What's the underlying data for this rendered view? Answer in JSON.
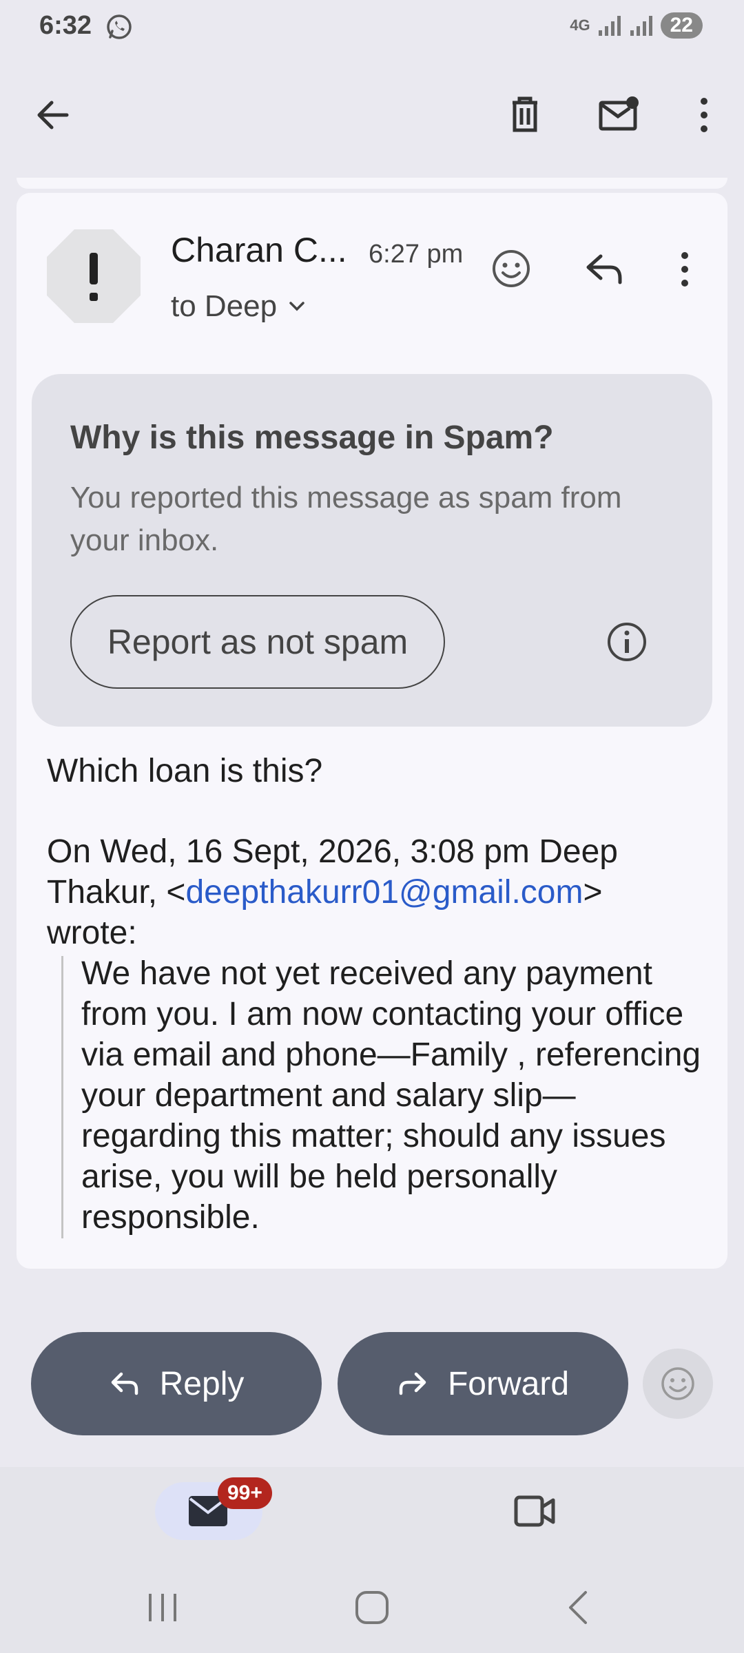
{
  "status_bar": {
    "time": "6:32",
    "network": "4G",
    "battery": "22"
  },
  "message": {
    "sender": "Charan C...",
    "time": "6:27 pm",
    "recipient": "to Deep"
  },
  "spam_notice": {
    "title": "Why is this message in Spam?",
    "description": "You reported this message as spam from your inbox.",
    "button_label": "Report as not spam"
  },
  "body": {
    "question": "Which loan is this?",
    "attribution_prefix": "On Wed, 16 Sept, 2026, 3:08 pm Deep Thakur, <",
    "email": "deepthakurr01@gmail.com",
    "attribution_suffix": ">",
    "wrote": "wrote:",
    "quoted": "We have not yet received any payment from you. I am now contacting your office via email and phone—Family , referencing your department and salary slip—regarding this matter; should any issues arise, you will be held personally responsible."
  },
  "actions": {
    "reply_label": "Reply",
    "forward_label": "Forward"
  },
  "bottom_nav": {
    "mail_badge": "99+"
  },
  "colors": {
    "accent_link": "#2a5bc9",
    "pill_button": "#565d6d",
    "badge": "#b3261e"
  }
}
